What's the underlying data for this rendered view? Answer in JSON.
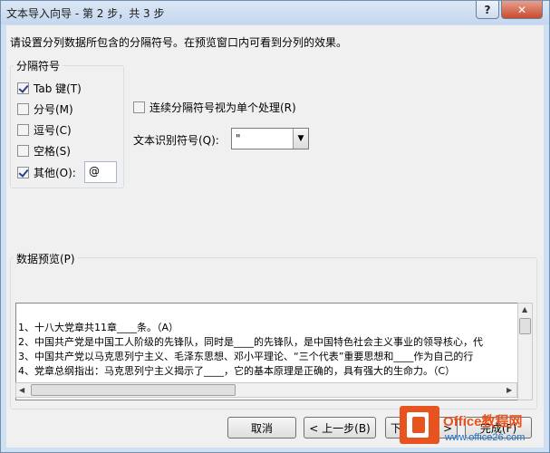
{
  "window": {
    "title": "文本导入向导 - 第 2 步，共 3 步"
  },
  "titlebar_buttons": {
    "help": "?",
    "close": "✕"
  },
  "instruction": "请设置分列数据所包含的分隔符号。在预览窗口内可看到分列的效果。",
  "delimiters": {
    "group_label": "分隔符号",
    "items": [
      {
        "label": "Tab 键(T)",
        "checked": true
      },
      {
        "label": "分号(M)",
        "checked": false
      },
      {
        "label": "逗号(C)",
        "checked": false
      },
      {
        "label": "空格(S)",
        "checked": false
      },
      {
        "label": "其他(O):",
        "checked": true
      }
    ],
    "other_value": "@"
  },
  "options": {
    "consecutive_label": "连续分隔符号视为单个处理(R)",
    "consecutive_checked": false,
    "text_qualifier_label": "文本识别符号(Q):",
    "text_qualifier_value": "\""
  },
  "preview": {
    "group_label": "数据预览(P)",
    "lines": [
      "1、十八大党章共11章____条。（A）",
      "2、中国共产党是中国工人阶级的先锋队，同时是____的先锋队，是中国特色社会主义事业的领导核心，代",
      "3、中国共产党以马克思列宁主义、毛泽东思想、邓小平理论、“三个代表”重要思想和____作为自己的行",
      "4、党章总纲指出：马克思列宁主义揭示了____，它的基本原理是正确的，具有强大的生命力。（C）"
    ]
  },
  "buttons": {
    "cancel": "取消",
    "back": "< 上一步(B)",
    "next": "下一步(N) >",
    "finish": "完成(F)"
  },
  "watermark": {
    "brand": "Office教程网",
    "url": "www.office26.com"
  },
  "colors": {
    "accent": "#e8541f",
    "watermark_blue": "#1f6fc0"
  }
}
